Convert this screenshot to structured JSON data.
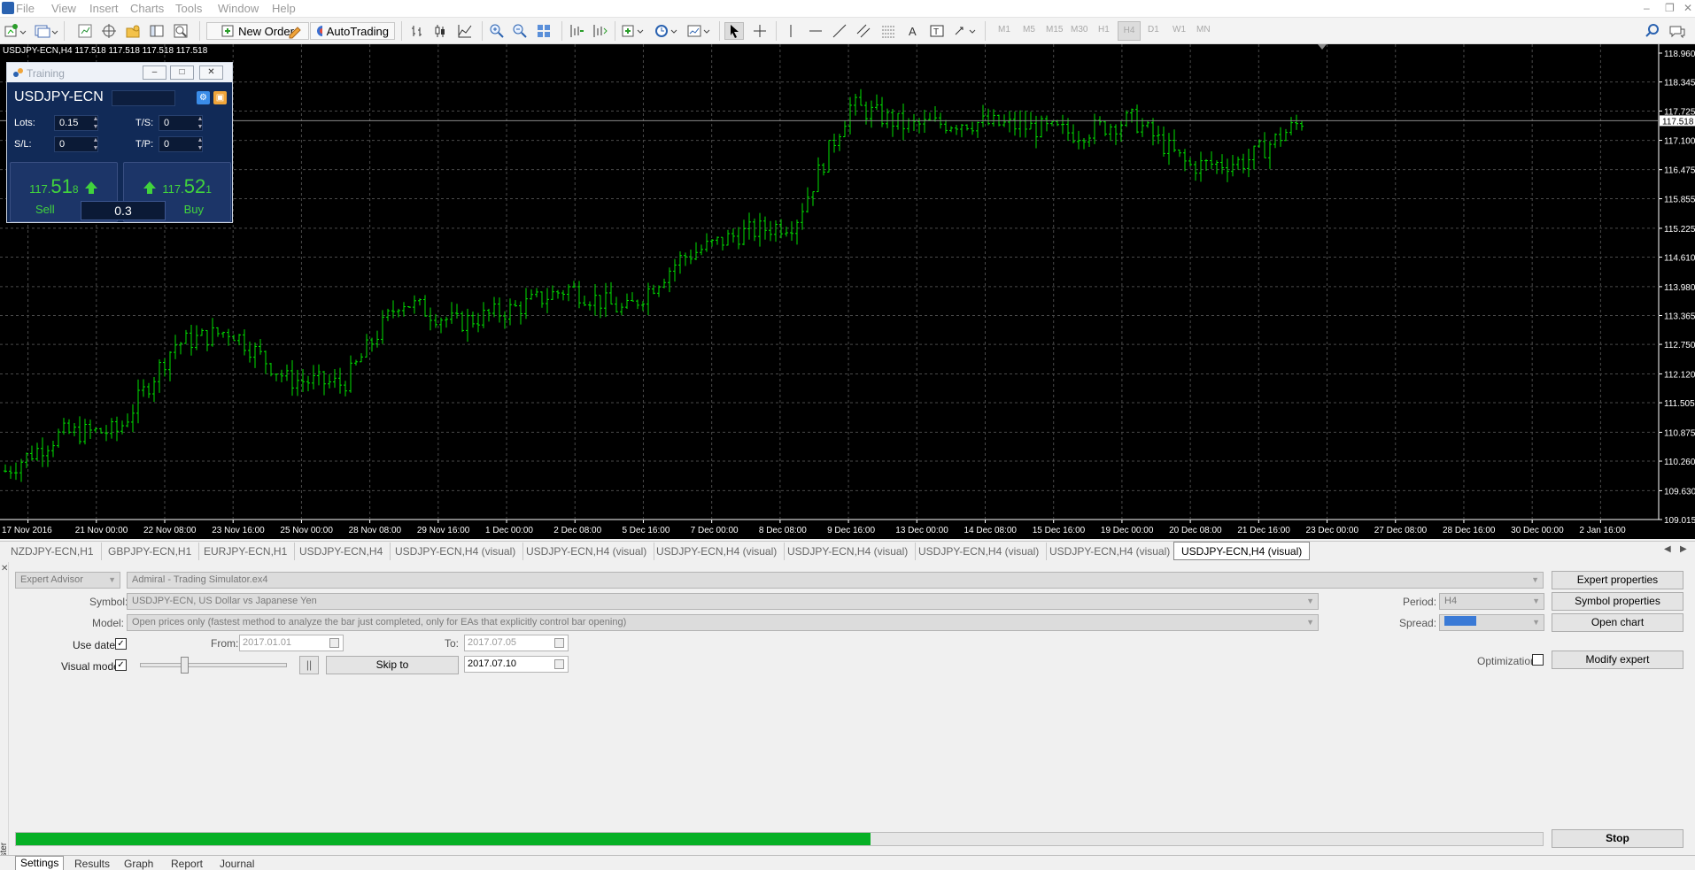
{
  "menu": {
    "items": [
      "File",
      "View",
      "Insert",
      "Charts",
      "Tools",
      "Window",
      "Help"
    ]
  },
  "toolbar": {
    "new_order_label": "New Order",
    "autotrading_label": "AutoTrading",
    "timeframes": [
      "M1",
      "M5",
      "M15",
      "M30",
      "H1",
      "H4",
      "D1",
      "W1",
      "MN"
    ],
    "active_timeframe": "H4"
  },
  "chart": {
    "header": "USDJPY-ECN,H4  117.518 117.518 117.518 117.518",
    "current_price": "117.518",
    "price_labels": [
      "118.960",
      "118.345",
      "117.725",
      "117.100",
      "116.475",
      "115.855",
      "115.225",
      "114.610",
      "113.980",
      "113.365",
      "112.750",
      "112.120",
      "111.505",
      "110.875",
      "110.260",
      "109.630",
      "109.015"
    ],
    "time_labels": [
      "17 Nov 2016",
      "21 Nov 00:00",
      "22 Nov 08:00",
      "23 Nov 16:00",
      "25 Nov 00:00",
      "28 Nov 08:00",
      "29 Nov 16:00",
      "1 Dec 00:00",
      "2 Dec 08:00",
      "5 Dec 16:00",
      "7 Dec 00:00",
      "8 Dec 08:00",
      "9 Dec 16:00",
      "13 Dec 00:00",
      "14 Dec 08:00",
      "15 Dec 16:00",
      "19 Dec 00:00",
      "20 Dec 08:00",
      "21 Dec 16:00",
      "23 Dec 00:00",
      "27 Dec 08:00",
      "28 Dec 16:00",
      "30 Dec 00:00",
      "2 Jan 16:00"
    ],
    "colors": {
      "background": "#000000",
      "bars": "#00e100",
      "grid": "#4a4a4a",
      "text": "#ffffff"
    }
  },
  "chart_data": {
    "type": "ohlc",
    "symbol": "USDJPY-ECN",
    "timeframe": "H4",
    "ylim": [
      109.015,
      118.96
    ],
    "x": [
      "17 Nov 2016",
      "21 Nov 00:00",
      "22 Nov 08:00",
      "23 Nov 16:00",
      "25 Nov 00:00",
      "28 Nov 08:00",
      "29 Nov 16:00",
      "1 Dec 00:00",
      "2 Dec 08:00",
      "5 Dec 16:00",
      "7 Dec 00:00",
      "8 Dec 08:00",
      "9 Dec 16:00",
      "13 Dec 00:00",
      "14 Dec 08:00",
      "15 Dec 16:00",
      "19 Dec 00:00",
      "20 Dec 08:00",
      "21 Dec 16:00",
      "23 Dec 00:00",
      "27 Dec 08:00",
      "28 Dec 16:00",
      "30 Dec 00:00",
      "2 Jan 16:00"
    ],
    "close": [
      110.05,
      110.85,
      110.9,
      112.75,
      113.05,
      112.0,
      111.9,
      113.7,
      113.2,
      113.5,
      113.95,
      113.45,
      114.6,
      115.1,
      115.35,
      117.85,
      117.4,
      117.5,
      117.4,
      117.25,
      117.55,
      116.55,
      116.65,
      117.52
    ],
    "grid": true
  },
  "panel": {
    "title": "Training",
    "symbol": "USDJPY-ECN",
    "lots_label": "Lots:",
    "lots_value": "0.15",
    "sl_label": "S/L:",
    "sl_value": "0",
    "ts_label": "T/S:",
    "ts_value": "0",
    "tp_label": "T/P:",
    "tp_value": "0",
    "sell": {
      "small": "117.",
      "big": "51",
      "after": "8",
      "label": "Sell"
    },
    "buy": {
      "small": "117.",
      "big": "52",
      "after": "1",
      "label": "Buy"
    },
    "lot_size": "0.3"
  },
  "chart_tabs": [
    "NZDJPY-ECN,H1",
    "GBPJPY-ECN,H1",
    "EURJPY-ECN,H1",
    "USDJPY-ECN,H4",
    "USDJPY-ECN,H4 (visual)",
    "USDJPY-ECN,H4 (visual)",
    "USDJPY-ECN,H4 (visual)",
    "USDJPY-ECN,H4 (visual)",
    "USDJPY-ECN,H4 (visual)",
    "USDJPY-ECN,H4 (visual)",
    "USDJPY-ECN,H4 (visual)"
  ],
  "active_chart_tab": 10,
  "tester": {
    "mode": "Expert Advisor",
    "expert": "Admiral - Trading Simulator.ex4",
    "symbol_label": "Symbol:",
    "symbol": "USDJPY-ECN, US Dollar vs Japanese Yen",
    "model_label": "Model:",
    "model": "Open prices only (fastest method to analyze the bar just completed, only for EAs that explicitly control bar opening)",
    "period_label": "Period:",
    "period": "H4",
    "spread_label": "Spread:",
    "spread": "",
    "use_date_label": "Use date",
    "use_date_checked": true,
    "from_label": "From:",
    "from": "2017.01.01",
    "to_label": "To:",
    "to": "2017.07.05",
    "optimization_label": "Optimization",
    "visual_mode_label": "Visual mode",
    "visual_mode_checked": true,
    "pause_label": "||",
    "skip_to_label": "Skip to",
    "skip_to_date": "2017.07.10",
    "visual_speed": 0.28,
    "expert_properties_label": "Expert properties",
    "symbol_properties_label": "Symbol properties",
    "open_chart_label": "Open chart",
    "modify_expert_label": "Modify expert",
    "stop_label": "Stop",
    "progress": 0.56,
    "sidebar_label": "Tester"
  },
  "bottom_tabs": [
    "Settings",
    "Results",
    "Graph",
    "Report",
    "Journal"
  ],
  "active_bottom_tab": 0
}
